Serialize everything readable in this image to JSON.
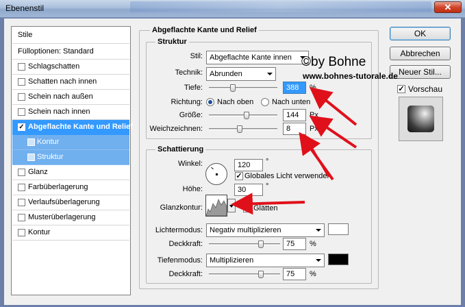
{
  "window": {
    "title": "Ebenenstil",
    "close_glyph": "✕"
  },
  "left_list": {
    "header": "Stile",
    "items": [
      {
        "label": "Fülloptionen: Standard",
        "checkbox": false,
        "checked": false,
        "state": "normal"
      },
      {
        "label": "Schlagschatten",
        "checkbox": true,
        "checked": false,
        "state": "normal"
      },
      {
        "label": "Schatten nach innen",
        "checkbox": true,
        "checked": false,
        "state": "normal"
      },
      {
        "label": "Schein nach außen",
        "checkbox": true,
        "checked": false,
        "state": "normal"
      },
      {
        "label": "Schein nach innen",
        "checkbox": true,
        "checked": false,
        "state": "normal"
      },
      {
        "label": "Abgeflachte Kante und Relief",
        "checkbox": true,
        "checked": true,
        "state": "selected"
      },
      {
        "label": "Kontur",
        "checkbox": true,
        "checked": false,
        "state": "sub"
      },
      {
        "label": "Struktur",
        "checkbox": true,
        "checked": false,
        "state": "sub"
      },
      {
        "label": "Glanz",
        "checkbox": true,
        "checked": false,
        "state": "normal"
      },
      {
        "label": "Farbüberlagerung",
        "checkbox": true,
        "checked": false,
        "state": "normal"
      },
      {
        "label": "Verlaufsüberlagerung",
        "checkbox": true,
        "checked": false,
        "state": "normal"
      },
      {
        "label": "Musterüberlagerung",
        "checkbox": true,
        "checked": false,
        "state": "normal"
      },
      {
        "label": "Kontur",
        "checkbox": true,
        "checked": false,
        "state": "normal"
      }
    ]
  },
  "main": {
    "group_title": "Abgeflachte Kante und Relief",
    "struktur": {
      "title": "Struktur",
      "stil_label": "Stil:",
      "stil_value": "Abgeflachte Kante innen",
      "technik_label": "Technik:",
      "technik_value": "Abrunden",
      "tiefe_label": "Tiefe:",
      "tiefe_value": "388",
      "tiefe_unit": "%",
      "tiefe_slider": 0.34,
      "richtung_label": "Richtung:",
      "richtung_oben": "Nach oben",
      "richtung_unten": "Nach unten",
      "groesse_label": "Größe:",
      "groesse_value": "144",
      "groesse_unit": "Px",
      "groesse_slider": 0.55,
      "weich_label": "Weichzeichnen:",
      "weich_value": "8",
      "weich_unit": "Px",
      "weich_slider": 0.45
    },
    "schattierung": {
      "title": "Schattierung",
      "winkel_label": "Winkel:",
      "winkel_value": "120",
      "winkel_unit": "°",
      "globales_licht_label": "Globales Licht verwenden",
      "globales_licht_checked": true,
      "hoehe_label": "Höhe:",
      "hoehe_value": "30",
      "hoehe_unit": "°",
      "glanzkontur_label": "Glanzkontur:",
      "glaetten_label": "Glätten",
      "lichtermodus_label": "Lichtermodus:",
      "lichtermodus_value": "Negativ multiplizieren",
      "lichter_color": "#ffffff",
      "deckkraft1_label": "Deckkraft:",
      "deckkraft1_value": "75",
      "deckkraft1_unit": "%",
      "deckkraft1_slider": 0.75,
      "tiefenmodus_label": "Tiefenmodus:",
      "tiefenmodus_value": "Multiplizieren",
      "tiefen_color": "#000000",
      "deckkraft2_label": "Deckkraft:",
      "deckkraft2_value": "75",
      "deckkraft2_unit": "%",
      "deckkraft2_slider": 0.75
    }
  },
  "buttons": {
    "ok": "OK",
    "cancel": "Abbrechen",
    "new_style": "Neuer Stil...",
    "preview_label": "Vorschau",
    "preview_checked": true
  },
  "watermark": {
    "line1": "©by Bohne",
    "line2": "www.bohnes-tutorale.de"
  },
  "accent_colors": {
    "selection": "#3399ff",
    "sub_selection": "#70b0ef",
    "arrow": "#e0101a"
  }
}
